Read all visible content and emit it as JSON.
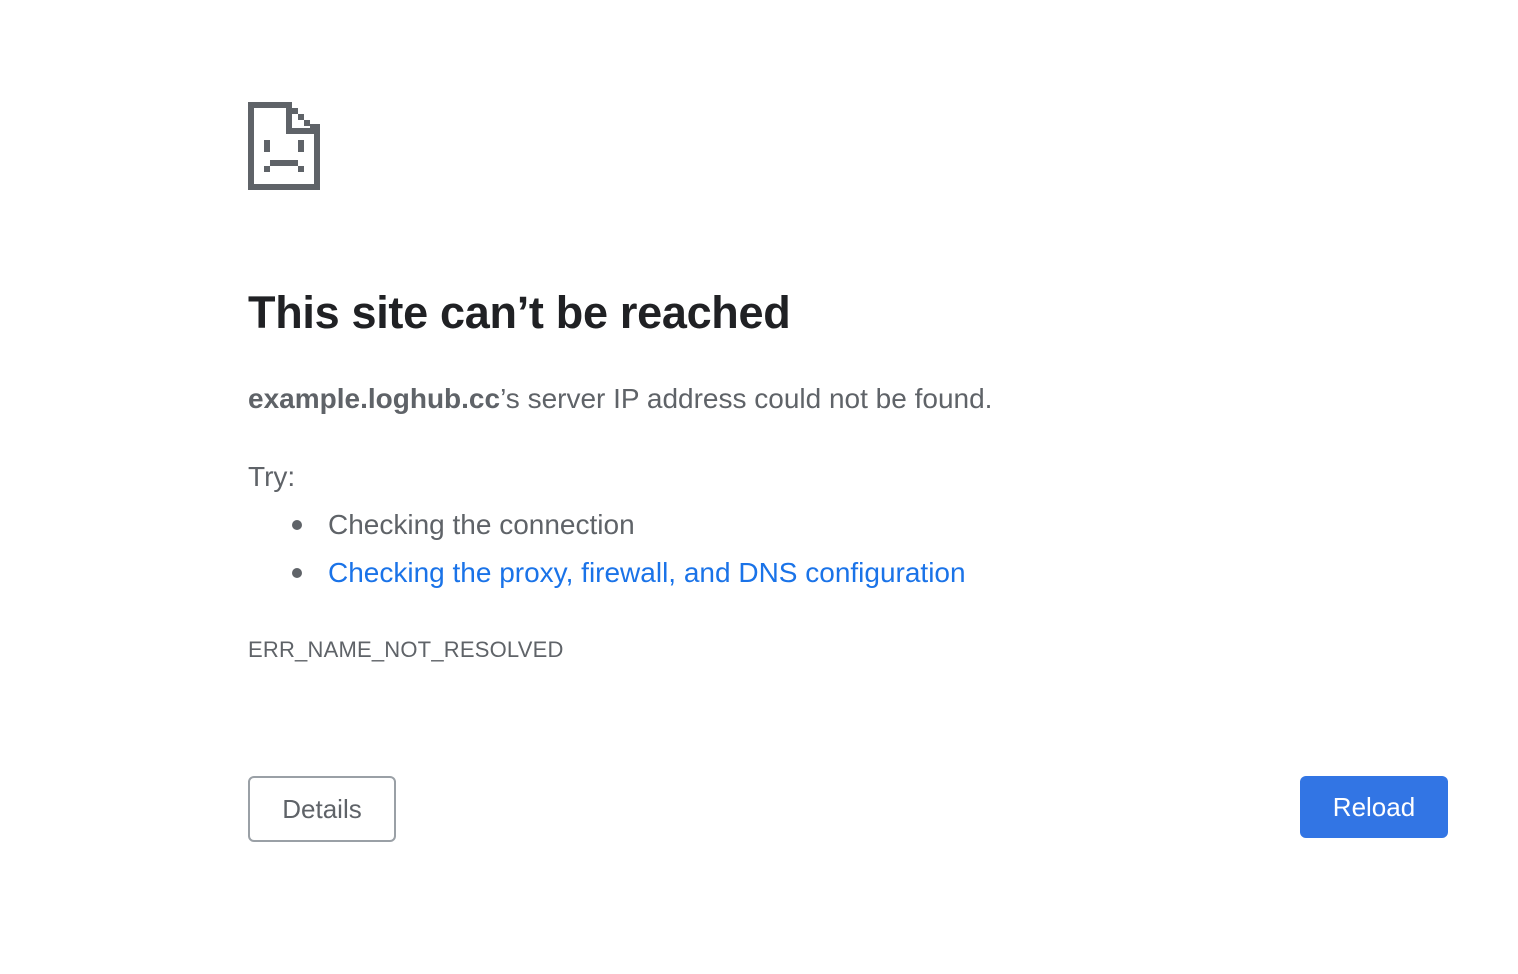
{
  "error_page": {
    "icon": "sad-document-icon",
    "heading": "This site can’t be reached",
    "summary": {
      "host": "example.loghub.cc",
      "message": "’s server IP address could not be found."
    },
    "try_label": "Try:",
    "suggestions": [
      {
        "text": "Checking the connection",
        "is_link": false
      },
      {
        "text": "Checking the proxy, firewall, and DNS configuration",
        "is_link": true
      }
    ],
    "error_code": "ERR_NAME_NOT_RESOLVED",
    "buttons": {
      "details_label": "Details",
      "reload_label": "Reload"
    }
  },
  "colors": {
    "heading": "#202124",
    "body_text": "#5f6368",
    "link": "#1a73e8",
    "reload_button": "#3275e4",
    "details_border": "#9aa0a6"
  }
}
